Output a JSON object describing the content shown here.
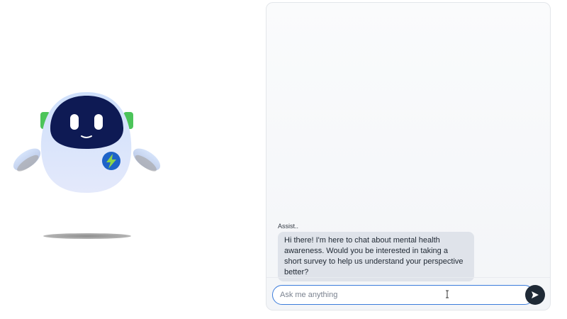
{
  "mascot": {
    "icon": "robot-mascot",
    "badge_icon": "lightning-bolt-icon",
    "colors": {
      "body": "#dbe6fb",
      "visor": "#0e1a54",
      "ears": "#4cc45a",
      "badge": "#1e63c8",
      "bolt": "#8ad44a",
      "shadow": "#9a9a9a"
    }
  },
  "chat": {
    "messages": [
      {
        "sender": "Assist..",
        "text": "Hi there! I'm here to chat about mental health awareness. Would you be interested in taking a short survey to help us understand your perspective better?"
      }
    ],
    "input": {
      "placeholder": "Ask me anything",
      "value": ""
    },
    "send_icon": "send-arrow-icon",
    "colors": {
      "bubble": "#dfe3ea",
      "input_border": "#3b7cdb",
      "send_button": "#1f2a36"
    }
  }
}
